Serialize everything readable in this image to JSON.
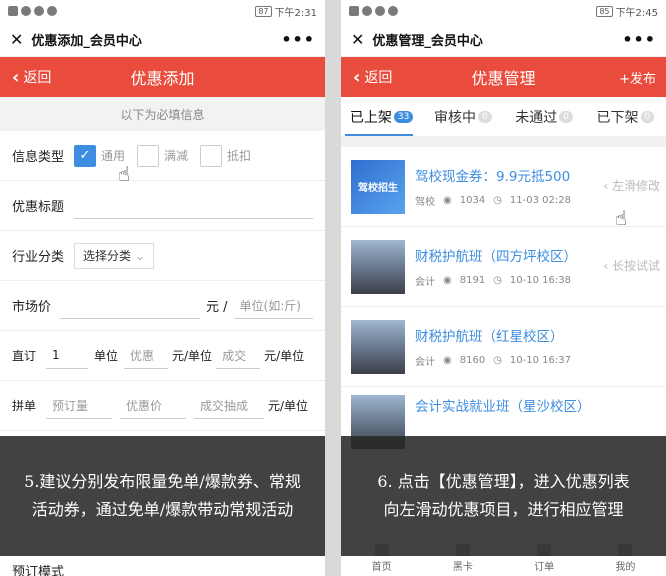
{
  "left": {
    "status": {
      "battery": "87",
      "time": "下午2:31"
    },
    "wx_title": "优惠添加_会员中心",
    "back": "返回",
    "page_title": "优惠添加",
    "required_note": "以下为必填信息",
    "info_type": {
      "label": "信息类型",
      "options": [
        "通用",
        "满减",
        "抵扣"
      ],
      "selected": "通用"
    },
    "coupon_title": {
      "label": "优惠标题"
    },
    "industry": {
      "label": "行业分类",
      "select": "选择分类"
    },
    "market_price": {
      "label": "市场价",
      "unit_sep": "元 /",
      "unit_placeholder": "单位(如:斤)"
    },
    "direct_order": {
      "label": "直订",
      "qty": "1",
      "unit": "单位",
      "discount_ph": "优惠",
      "per_unit1": "元/单位",
      "deal_ph": "成交",
      "per_unit2": "元/单位"
    },
    "group_buy": {
      "label": "拼单",
      "order_ph": "预订量",
      "price_ph": "优惠价",
      "deal_ph": "成交抽成",
      "per_unit": "元/单位"
    },
    "preorder": {
      "label": "预订模式"
    },
    "overlay": [
      "5.建议分别发布限量免单/爆款券、常规",
      "活动券，通过免单/爆款带动常规活动"
    ]
  },
  "right": {
    "status": {
      "battery": "85",
      "time": "下午2:45"
    },
    "wx_title": "优惠管理_会员中心",
    "back": "返回",
    "page_title": "优惠管理",
    "publish": "+发布",
    "tabs": [
      {
        "label": "已上架",
        "count": "33"
      },
      {
        "label": "审核中",
        "count": "0"
      },
      {
        "label": "未通过",
        "count": "0"
      },
      {
        "label": "已下架",
        "count": "0"
      }
    ],
    "items": [
      {
        "title": "驾校现金券：9.9元抵500",
        "category": "驾校",
        "views": "1034",
        "time": "11-03 02:28",
        "hint": "左滑修改",
        "thumb_text": "驾校招生"
      },
      {
        "title": "财税护航班（四方坪校区）",
        "category": "会计",
        "views": "8191",
        "time": "10-10 16:38",
        "hint": "长按试试"
      },
      {
        "title": "财税护航班（红星校区）",
        "category": "会计",
        "views": "8160",
        "time": "10-10 16:37"
      },
      {
        "title": "会计实战就业班（星沙校区）"
      }
    ],
    "bottom_tabs": [
      "首页",
      "黑卡",
      "订单",
      "我的"
    ],
    "overlay": [
      "6. 点击【优惠管理】，进入优惠列表",
      "向左滑动优惠项目，进行相应管理"
    ]
  }
}
